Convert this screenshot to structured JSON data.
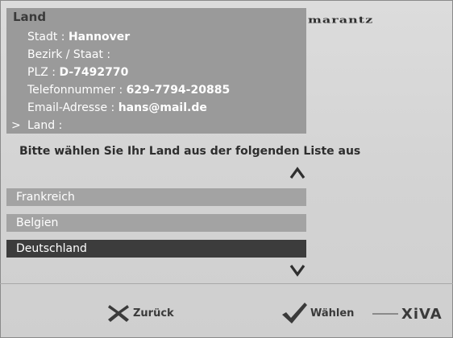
{
  "info": {
    "heading": "Land",
    "rows": [
      {
        "label": "Stadt : ",
        "value": "Hannover"
      },
      {
        "label": "Bezirk / Staat :",
        "value": ""
      },
      {
        "label": "PLZ : ",
        "value": "D-7492770"
      },
      {
        "label": "Telefonnummer : ",
        "value": "629-7794-20885"
      },
      {
        "label": "Email-Adresse : ",
        "value": "hans@mail.de"
      },
      {
        "label": "Land :",
        "value": "",
        "marker": ">"
      }
    ]
  },
  "brand": "marantz",
  "prompt": "Bitte wählen Sie Ihr Land aus der folgenden Liste aus",
  "list": {
    "items": [
      "Frankreich",
      "Belgien",
      "Deutschland"
    ],
    "selected_index": 2
  },
  "footer": {
    "back_label": "Zurück",
    "select_label": "Wählen",
    "powered_by": "XiVA"
  },
  "colors": {
    "panel": "#9a9a9a",
    "selected_row": "#3c3c3c",
    "row": "#a3a3a3"
  }
}
